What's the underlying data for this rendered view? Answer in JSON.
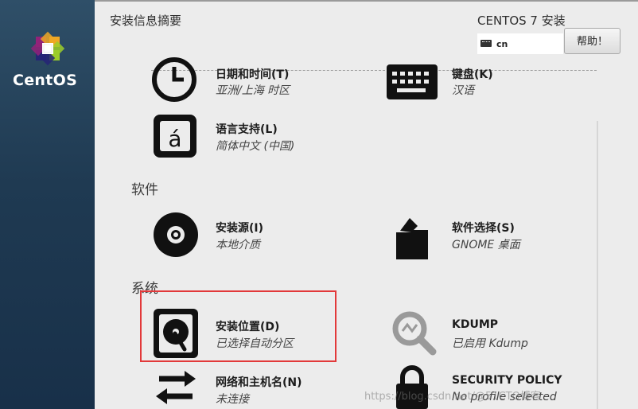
{
  "sidebar": {
    "brand": "CentOS"
  },
  "header": {
    "title": "安装信息摘要",
    "product": "CENTOS 7 安装",
    "keyboard_layout": "cn",
    "help_label": "帮助！"
  },
  "localization": [
    {
      "title": "日期和时间(T)",
      "subtitle": "亚洲/上海 时区",
      "icon": "clock-icon"
    },
    {
      "title": "键盘(K)",
      "subtitle": "汉语",
      "icon": "keyboard-icon"
    },
    {
      "title": "语言支持(L)",
      "subtitle": "简体中文 (中国)",
      "icon": "language-icon"
    }
  ],
  "software": {
    "heading": "软件",
    "items": [
      {
        "title": "安装源(I)",
        "subtitle": "本地介质",
        "icon": "disc-icon"
      },
      {
        "title": "软件选择(S)",
        "subtitle": "GNOME 桌面",
        "icon": "package-icon"
      }
    ]
  },
  "system": {
    "heading": "系统",
    "items": [
      {
        "title": "安装位置(D)",
        "subtitle": "已选择自动分区",
        "icon": "harddisk-icon"
      },
      {
        "title": "KDUMP",
        "subtitle": "已启用 Kdump",
        "icon": "magnifier-icon"
      },
      {
        "title": "网络和主机名(N)",
        "subtitle": "未连接",
        "icon": "network-arrows-icon"
      },
      {
        "title": "SECURITY POLICY",
        "subtitle": "No profile selected",
        "icon": "lock-icon"
      }
    ]
  },
  "watermark": "https://blog.csdn.net/@51CTO博客"
}
